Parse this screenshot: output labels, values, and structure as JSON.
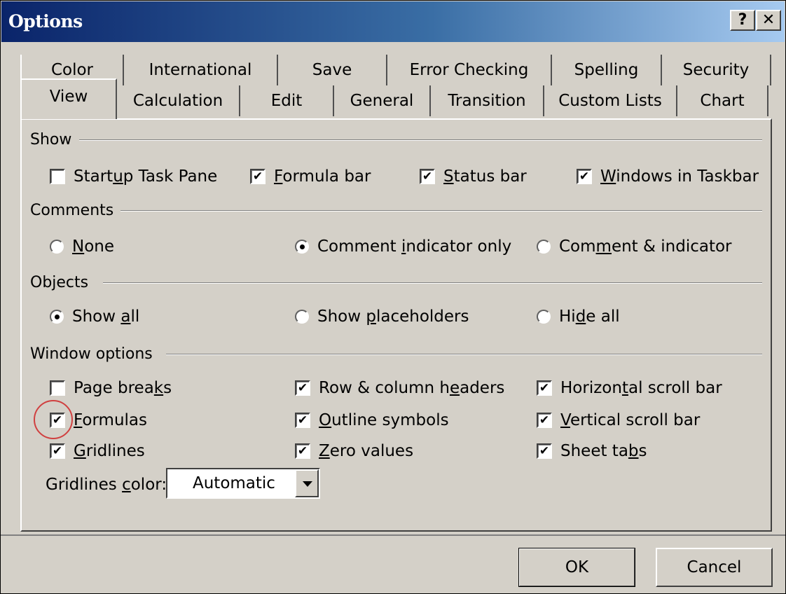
{
  "window": {
    "title": "Options",
    "help_label": "?",
    "close_label": "✕"
  },
  "tabs": {
    "row1": [
      "Color",
      "International",
      "Save",
      "Error Checking",
      "Spelling",
      "Security"
    ],
    "row2": [
      "View",
      "Calculation",
      "Edit",
      "General",
      "Transition",
      "Custom Lists",
      "Chart"
    ],
    "selected": "View"
  },
  "show": {
    "label": "Show",
    "startup_task_pane": {
      "pre": "Start",
      "u": "u",
      "post": "p Task Pane",
      "checked": false
    },
    "formula_bar": {
      "pre": "",
      "u": "F",
      "post": "ormula bar",
      "checked": true
    },
    "status_bar": {
      "pre": "",
      "u": "S",
      "post": "tatus bar",
      "checked": true
    },
    "windows_in_taskbar": {
      "pre": "",
      "u": "W",
      "post": "indows in Taskbar",
      "checked": true
    }
  },
  "comments": {
    "label": "Comments",
    "none": {
      "pre": "",
      "u": "N",
      "post": "one",
      "selected": false
    },
    "indicator_only": {
      "pre": "Comment ",
      "u": "i",
      "post": "ndicator only",
      "selected": true
    },
    "comment_and_indicator": {
      "pre": "Com",
      "u": "m",
      "post": "ent & indicator",
      "selected": false
    }
  },
  "objects": {
    "label": "Objects",
    "show_all": {
      "pre": "Show ",
      "u": "a",
      "post": "ll",
      "selected": true
    },
    "show_placeholders": {
      "pre": "Show ",
      "u": "p",
      "post": "laceholders",
      "selected": false
    },
    "hide_all": {
      "pre": "Hi",
      "u": "d",
      "post": "e all",
      "selected": false
    }
  },
  "window_options": {
    "label": "Window options",
    "page_breaks": {
      "pre": "Page brea",
      "u": "k",
      "post": "s",
      "checked": false
    },
    "formulas": {
      "pre": "",
      "u": "F",
      "post": "ormulas",
      "checked": true
    },
    "gridlines": {
      "pre": "",
      "u": "G",
      "post": "ridlines",
      "checked": true
    },
    "row_column_headers": {
      "pre": "Row & column h",
      "u": "e",
      "post": "aders",
      "checked": true
    },
    "outline_symbols": {
      "pre": "",
      "u": "O",
      "post": "utline symbols",
      "checked": true
    },
    "zero_values": {
      "pre": "",
      "u": "Z",
      "post": "ero values",
      "checked": true
    },
    "horizontal_scroll_bar": {
      "pre": "Horizon",
      "u": "t",
      "post": "al scroll bar",
      "checked": true
    },
    "vertical_scroll_bar": {
      "pre": "",
      "u": "V",
      "post": "ertical scroll bar",
      "checked": true
    },
    "sheet_tabs": {
      "pre": "Sheet ta",
      "u": "b",
      "post": "s",
      "checked": true
    },
    "gridlines_color": {
      "pre": "Gridlines ",
      "u": "c",
      "post": "olor:",
      "value": "Automatic"
    }
  },
  "buttons": {
    "ok": "OK",
    "cancel": "Cancel"
  },
  "colors": {
    "dialog_bg": "#d4d0c8",
    "title_start": "#0a246a",
    "title_end": "#a6caf0",
    "highlight": "#d04040"
  },
  "check_glyph": "✔"
}
